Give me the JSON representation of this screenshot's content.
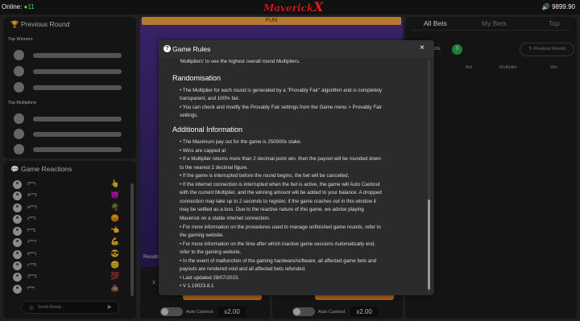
{
  "header": {
    "online_label": "Online:",
    "online_count": "11",
    "logo_text": "Maverick",
    "logo_x": "X",
    "balance": "9899.90"
  },
  "previous_round": {
    "title": "Previous Round",
    "top_winners_label": "Top Winners",
    "top_multipliers_label": "Top Multipliers"
  },
  "reactions": {
    "title": "Game Reactions",
    "rows": [
      {
        "name": "0***r",
        "emoji": "👆"
      },
      {
        "name": "A***1",
        "emoji": "😈"
      },
      {
        "name": "w***1",
        "emoji": "🌴"
      },
      {
        "name": "v***1",
        "emoji": "😡"
      },
      {
        "name": "f***3",
        "emoji": "👈"
      },
      {
        "name": "2***7",
        "emoji": "💪"
      },
      {
        "name": "b***1",
        "emoji": "😎"
      },
      {
        "name": "c***5",
        "emoji": "😊"
      },
      {
        "name": "3***3",
        "emoji": "💯"
      },
      {
        "name": "f***f",
        "emoji": "💩"
      }
    ],
    "input_placeholder": "Send Emoji..."
  },
  "game": {
    "mode_banner": "FUN",
    "results_label": "Results",
    "bet_left_label": "X",
    "auto_cashout_label": "Auto Cashout",
    "multiplier_left": "x2.00",
    "multiplier_right": "x2.00"
  },
  "bets_panel": {
    "tabs": [
      "All Bets",
      "My Bets",
      "Top"
    ],
    "bets_label": "Bets:",
    "bets_count": "0",
    "previous_round_button": "Previous Round",
    "columns": [
      "Bet",
      "Multiplier",
      "Win"
    ]
  },
  "modal": {
    "title": "Game Rules",
    "close": "×",
    "intro_line": "'Multipliers' to see the highest overall round Multipliers.",
    "randomisation_title": "Randomisation",
    "randomisation_lines": [
      "• The Multiplier for each round is generated by a \"Provably Fair\" algorithm and is completely",
      "  transparent, and 100% fair.",
      "• You can check and modify the Provably Fair settings from the Game menu > Provably Fair",
      "  settings."
    ],
    "additional_title": "Additional Information",
    "additional_lines": [
      "• The Maximum pay out for the game is 250000x stake.",
      "• Wins are capped at",
      "• If a Multiplier returns more than 2 decimal point win, then the payout will be rounded down",
      "  to the nearest 2 decimal figure.",
      "• If the game is interrupted before the round begins, the bet will be cancelled.",
      "• If the internet connection is interrupted when the bet is active, the game will Auto Cashout",
      "  with the current Multiplier, and the winning amount will be added to your balance. A dropped",
      "  connection may take up to 2 seconds to register, if the game crashes out in this window it",
      "  may be settled as a loss. Due to the reactive nature of this game, we advise playing",
      "  Maverick on a stable internet connection.",
      "• For more information on the procedures used to manage unfinished game rounds, refer to",
      "  the gaming website.",
      "• For more information on the time after which inactive game sessions Automatically end,",
      "  refer to the gaming website.",
      "• In the event of malfunction of the gaming hardware/software, all affected game bets and",
      "  payouts are rendered void and all affected bets refunded.",
      "• Last updated 28/07/2023.",
      "• V 1.19023.8.1"
    ]
  }
}
